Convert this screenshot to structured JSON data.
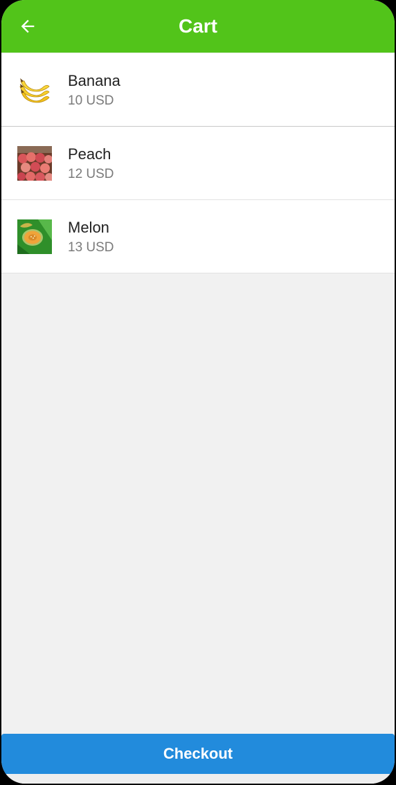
{
  "app_bar": {
    "title": "Cart",
    "back_icon": "arrow-left-icon",
    "color": "#52c41a"
  },
  "cart": {
    "items": [
      {
        "name": "Banana",
        "price": "10 USD",
        "image": "banana-image"
      },
      {
        "name": "Peach",
        "price": "12 USD",
        "image": "peach-image"
      },
      {
        "name": "Melon",
        "price": "13 USD",
        "image": "melon-image"
      }
    ]
  },
  "checkout": {
    "label": "Checkout",
    "color": "#228bdc"
  }
}
